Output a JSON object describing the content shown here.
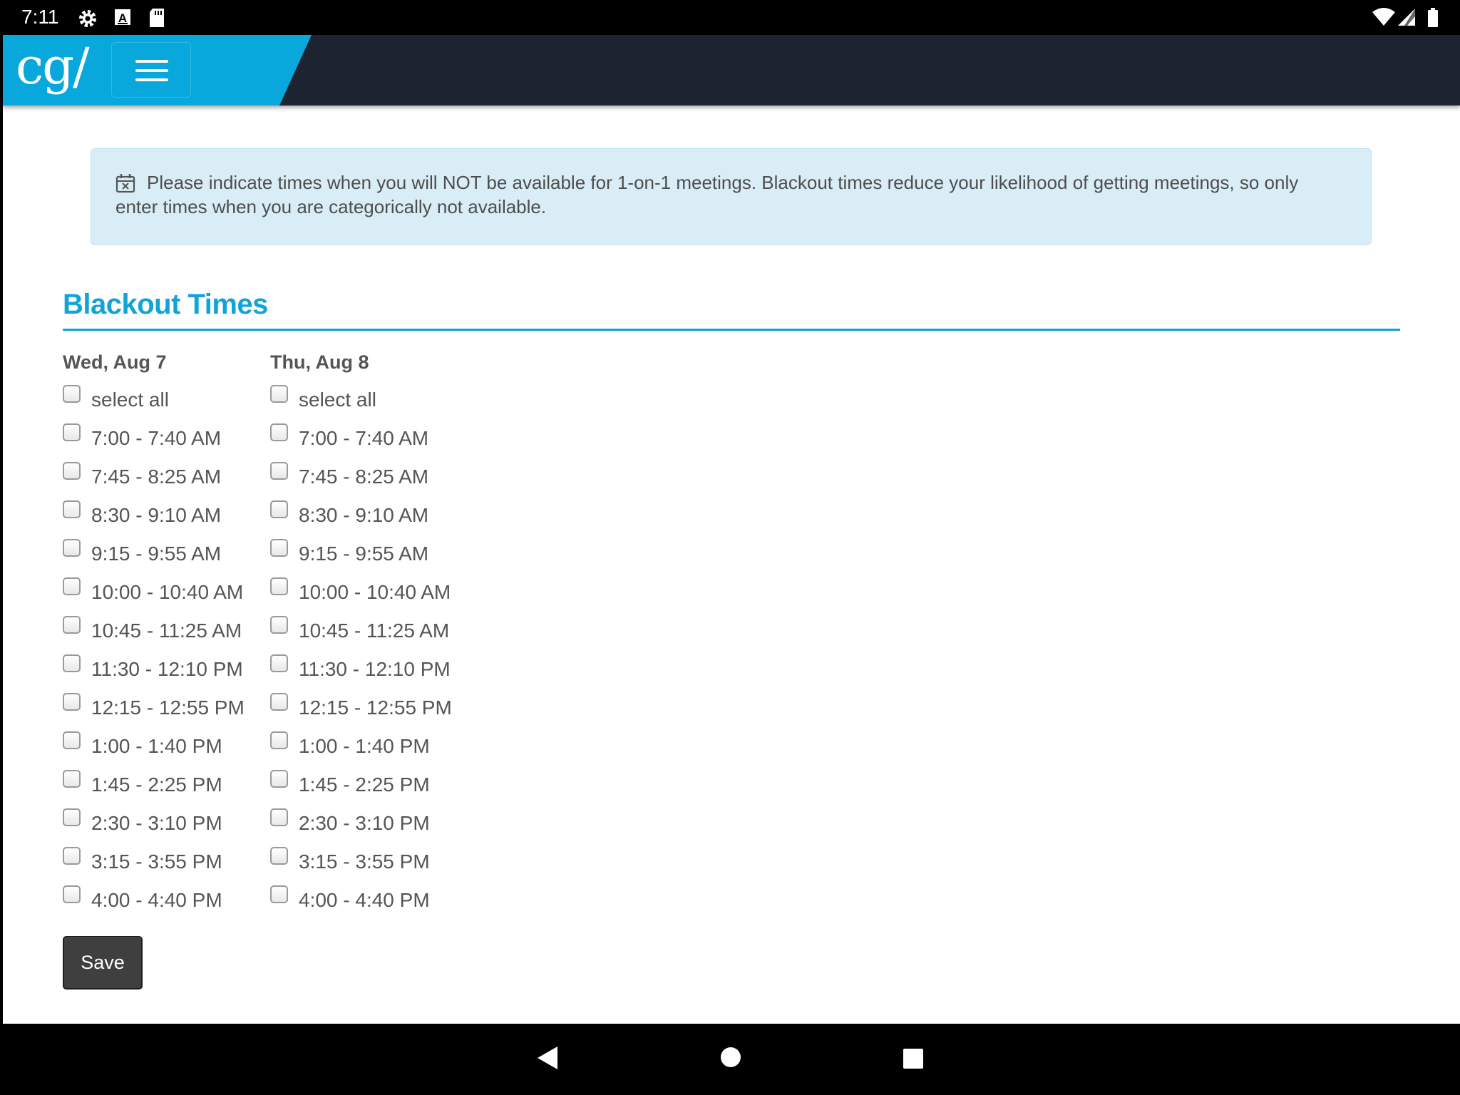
{
  "status_bar": {
    "time": "7:11",
    "icons": [
      "gear-icon",
      "a-notification-icon",
      "sd-card-icon",
      "wifi-icon",
      "signal-icon",
      "battery-icon"
    ]
  },
  "header": {
    "logo_text": "cg/",
    "menu_icon": "hamburger-menu-icon",
    "brand_color": "#08a8dd",
    "bar_color": "#1d2330"
  },
  "notice": {
    "icon": "calendar-x-icon",
    "text": "Please indicate times when you will NOT be available for 1-on-1 meetings. Blackout times reduce your likelihood of getting meetings, so only enter times when you are categorically not available."
  },
  "section": {
    "title": "Blackout Times",
    "accent": "#12a3d8"
  },
  "days": [
    {
      "title": "Wed, Aug 7",
      "select_all": "select all",
      "slots": [
        "7:00 - 7:40 AM",
        "7:45 - 8:25 AM",
        "8:30 - 9:10 AM",
        "9:15 - 9:55 AM",
        "10:00 - 10:40 AM",
        "10:45 - 11:25 AM",
        "11:30 - 12:10 PM",
        "12:15 - 12:55 PM",
        "1:00 - 1:40 PM",
        "1:45 - 2:25 PM",
        "2:30 - 3:10 PM",
        "3:15 - 3:55 PM",
        "4:00 - 4:40 PM"
      ]
    },
    {
      "title": "Thu, Aug 8",
      "select_all": "select all",
      "slots": [
        "7:00 - 7:40 AM",
        "7:45 - 8:25 AM",
        "8:30 - 9:10 AM",
        "9:15 - 9:55 AM",
        "10:00 - 10:40 AM",
        "10:45 - 11:25 AM",
        "11:30 - 12:10 PM",
        "12:15 - 12:55 PM",
        "1:00 - 1:40 PM",
        "1:45 - 2:25 PM",
        "2:30 - 3:10 PM",
        "3:15 - 3:55 PM",
        "4:00 - 4:40 PM"
      ]
    }
  ],
  "actions": {
    "save_label": "Save"
  },
  "nav_bar": {
    "icons": [
      "back-triangle-icon",
      "home-circle-icon",
      "recents-square-icon"
    ]
  }
}
